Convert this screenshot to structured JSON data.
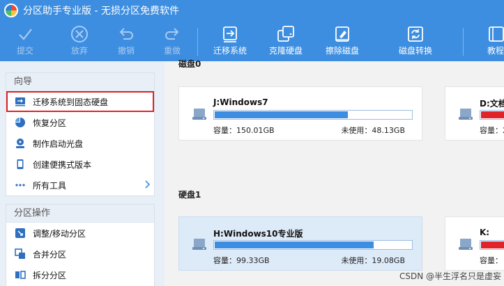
{
  "window": {
    "title": "分区助手专业版 - 无损分区免费软件"
  },
  "toolbar": [
    {
      "label": "提交",
      "icon": "check-icon",
      "disabled": true
    },
    {
      "label": "放弃",
      "icon": "cancel-circle-icon",
      "disabled": true
    },
    {
      "label": "撤销",
      "icon": "undo-icon",
      "disabled": true
    },
    {
      "label": "重做",
      "icon": "redo-icon",
      "disabled": true
    },
    {
      "label": "迁移系统",
      "icon": "migrate-os-icon",
      "disabled": false
    },
    {
      "label": "克隆硬盘",
      "icon": "clone-disk-icon",
      "disabled": false
    },
    {
      "label": "擦除磁盘",
      "icon": "wipe-disk-icon",
      "disabled": false
    },
    {
      "label": "磁盘转换",
      "icon": "convert-disk-icon",
      "disabled": false
    },
    {
      "label": "教程",
      "icon": "tutorial-icon",
      "disabled": false
    }
  ],
  "sidebar": {
    "wizard": {
      "heading": "向导",
      "items": [
        {
          "label": "迁移系统到固态硬盘",
          "icon": "migrate-ssd-icon",
          "selected": true
        },
        {
          "label": "恢复分区",
          "icon": "pie-recover-icon"
        },
        {
          "label": "制作启动光盘",
          "icon": "boot-cd-icon"
        },
        {
          "label": "创建便携式版本",
          "icon": "portable-device-icon"
        },
        {
          "label": "所有工具",
          "icon": "all-tools-icon",
          "has_submenu": true
        }
      ]
    },
    "partition_ops": {
      "heading": "分区操作",
      "items": [
        {
          "label": "调整/移动分区",
          "icon": "resize-move-icon"
        },
        {
          "label": "合并分区",
          "icon": "merge-icon"
        },
        {
          "label": "拆分分区",
          "icon": "split-icon"
        }
      ]
    }
  },
  "disks": [
    {
      "title": "磁盘0",
      "partitions": [
        {
          "name": "J:Windows7",
          "capacity": "容量：150.01GB",
          "unused": "未使用：48.13GB",
          "used_fraction": 0.68,
          "selected": false
        },
        {
          "name": "D:文档",
          "capacity": "容量：2",
          "unused": "",
          "used_fraction": 0.9,
          "selected": false,
          "warning": true
        }
      ]
    },
    {
      "title": "硬盘1",
      "partitions": [
        {
          "name": "H:Windows10专业版",
          "capacity": "容量：99.33GB",
          "unused": "未使用：19.08GB",
          "used_fraction": 0.81,
          "selected": true
        },
        {
          "name": "K:",
          "capacity": "容量：",
          "unused": "",
          "used_fraction": 0.9,
          "selected": false,
          "warning": true
        }
      ]
    }
  ],
  "watermark": "CSDN @半生浮名只是虚妄",
  "colors": {
    "accent": "#3d8ee0",
    "warning": "#e0242a",
    "selection_outline": "#e02020"
  }
}
